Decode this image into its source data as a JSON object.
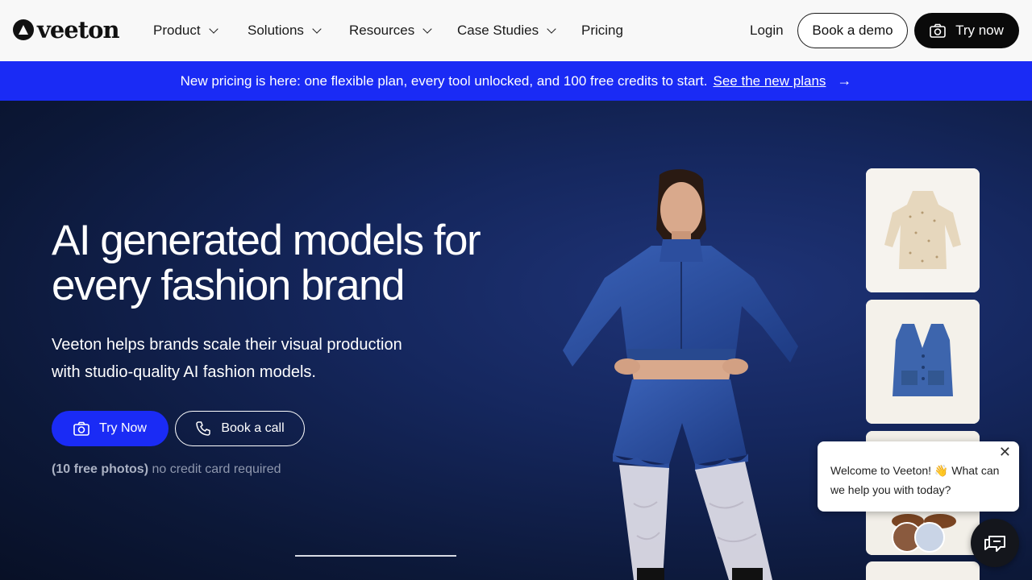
{
  "brand": {
    "name": "veeton"
  },
  "nav": {
    "items": [
      {
        "label": "Product",
        "dropdown": true
      },
      {
        "label": "Solutions",
        "dropdown": true
      },
      {
        "label": "Resources",
        "dropdown": true
      },
      {
        "label": "Case Studies",
        "dropdown": true
      },
      {
        "label": "Pricing",
        "dropdown": false
      }
    ],
    "login": "Login",
    "book_demo": "Book a demo",
    "try_now": "Try now"
  },
  "banner": {
    "text": "New pricing is here: one flexible plan, every tool unlocked, and 100 free credits to start.",
    "link": "See the new plans",
    "icon": "arrow-right-icon",
    "color": "#1a2bf5"
  },
  "hero": {
    "title_line1": "AI generated models for",
    "title_line2": "every fashion brand",
    "sub_line1": "Veeton helps brands scale their visual production",
    "sub_line2": "with studio-quality AI fashion models.",
    "cta_try": "Try Now",
    "cta_call": "Book a call",
    "note_bold": "(10 free photos)",
    "note_rest": " no credit card required"
  },
  "chat": {
    "message": "Welcome to Veeton! 👋 What can we help you with today?",
    "close": "✕"
  },
  "colors": {
    "accent": "#1a2bf5",
    "dark": "#0a0a0a",
    "hero_bg": "#15275e"
  }
}
